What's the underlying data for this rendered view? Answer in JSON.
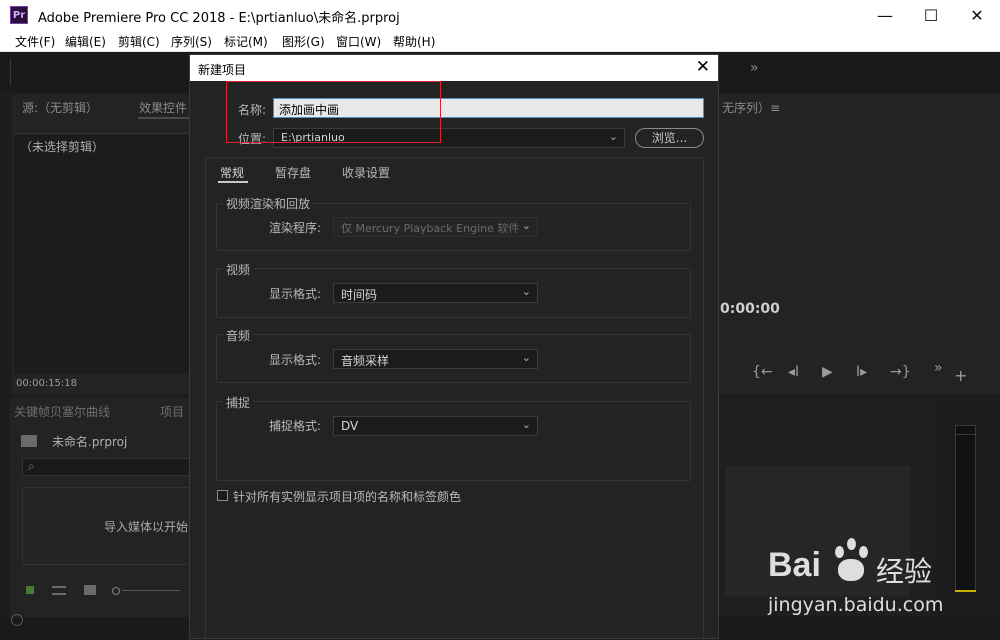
{
  "window": {
    "app_icon": "Pr",
    "title": "Adobe Premiere Pro CC 2018 - E:\\prtianluo\\未命名.prproj",
    "minimize": "—",
    "maximize": "☐",
    "close": "✕"
  },
  "menu": {
    "items": [
      "文件(F)",
      "编辑(E)",
      "剪辑(C)",
      "序列(S)",
      "标记(M)",
      "图形(G)",
      "窗口(W)",
      "帮助(H)"
    ]
  },
  "background": {
    "source_tab": "源:（无剪辑）",
    "effect_controls_tab": "效果控件",
    "no_clip": "（未选择剪辑）",
    "timecode_left": "00:00:15:18",
    "program_tab": "无序列）≡",
    "program_timecode": "0:00:00",
    "keyframe_tab": "关键帧贝塞尔曲线",
    "project_tab": "项目",
    "project_file": "未命名.prproj",
    "import_hint": "导入媒体以开始",
    "search_icon": "⌕",
    "expand_icon": "»"
  },
  "dialog": {
    "title": "新建项目",
    "close": "✕",
    "name_label": "名称:",
    "name_value": "添加画中画",
    "location_label": "位置:",
    "location_value": "E:\\prtianluo",
    "browse_button": "浏览...",
    "tabs": [
      "常规",
      "暂存盘",
      "收录设置"
    ],
    "groups": {
      "video_render": {
        "title": "视频渲染和回放",
        "renderer_label": "渲染程序:",
        "renderer_value": "仅 Mercury Playback Engine 软件"
      },
      "video": {
        "title": "视频",
        "format_label": "显示格式:",
        "format_value": "时间码"
      },
      "audio": {
        "title": "音频",
        "format_label": "显示格式:",
        "format_value": "音频采样"
      },
      "capture": {
        "title": "捕捉",
        "format_label": "捕捉格式:",
        "format_value": "DV"
      }
    },
    "checkbox_label": "针对所有实例显示项目项的名称和标签颜色",
    "checkbox_checked": false
  },
  "watermark": {
    "brand": "Bai",
    "brand_suffix": "经验",
    "url": "jingyan.baidu.com"
  },
  "colors": {
    "annotation_red": "#d9262c",
    "focus_blue": "#4f8ec9"
  }
}
